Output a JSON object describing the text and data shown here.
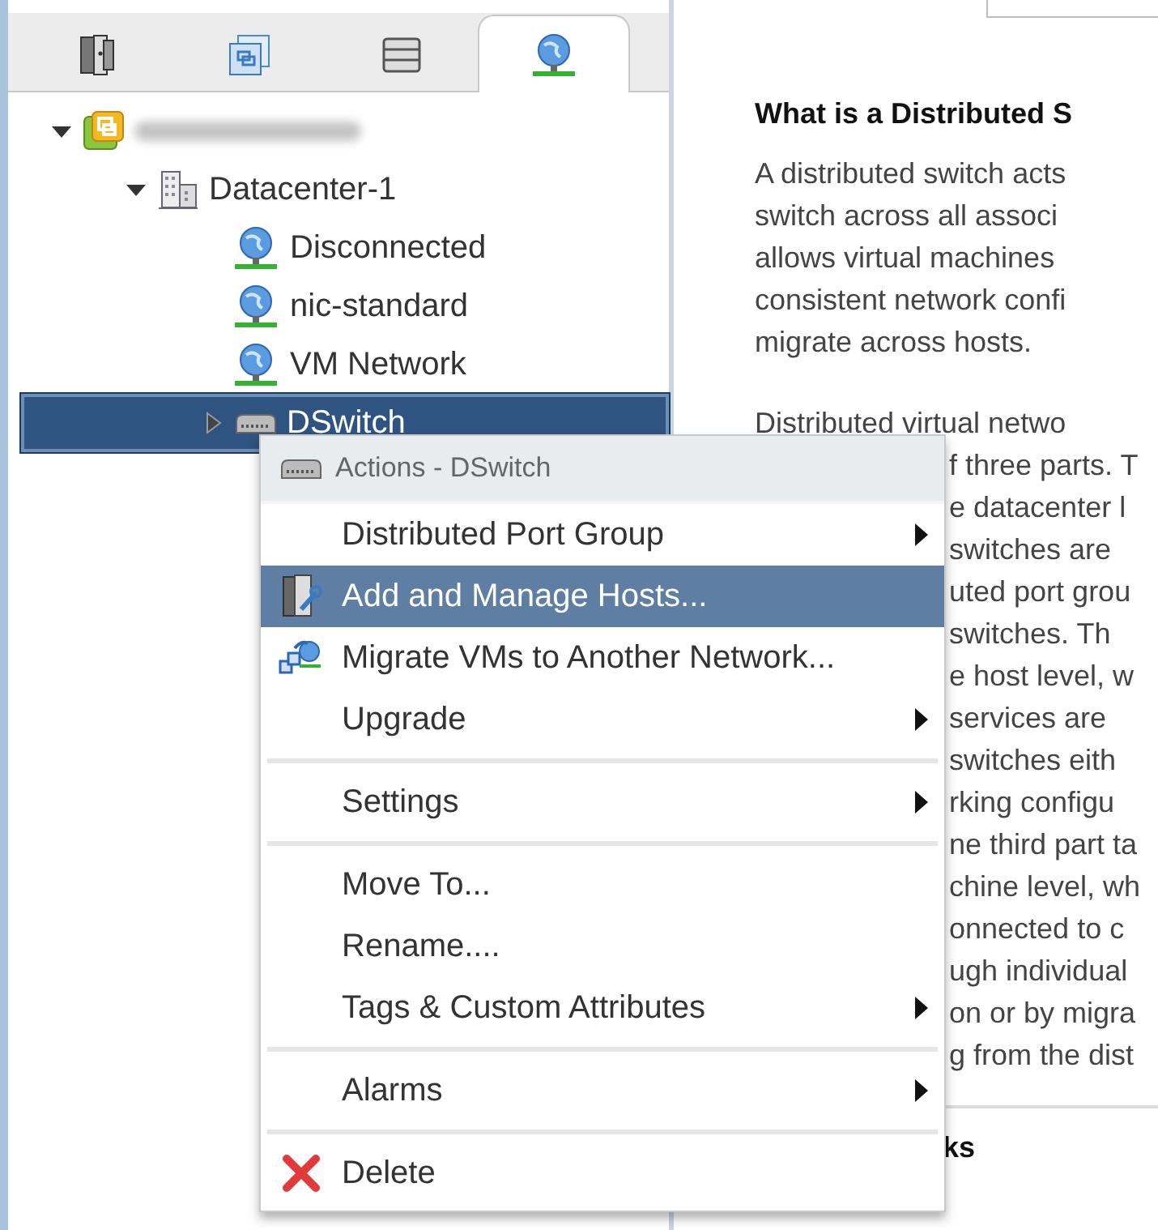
{
  "tabs": [
    {
      "kind": "hosts",
      "selected": false
    },
    {
      "kind": "vms",
      "selected": false
    },
    {
      "kind": "storage",
      "selected": false
    },
    {
      "kind": "network",
      "selected": true
    }
  ],
  "tree": [
    {
      "kind": "vcenter",
      "expanded": true,
      "selected": false,
      "children": [
        {
          "kind": "datacenter",
          "label": "Datacenter-1",
          "expanded": true,
          "selected": false,
          "children": [
            {
              "kind": "network",
              "label": "Disconnected",
              "selected": false
            },
            {
              "kind": "network",
              "label": "nic-standard",
              "selected": false
            },
            {
              "kind": "network",
              "label": "VM Network",
              "selected": false
            },
            {
              "kind": "dswitch",
              "label": "DSwitch",
              "expanded": false,
              "selected": true
            }
          ]
        }
      ]
    }
  ],
  "help": {
    "heading": "What is a Distributed S",
    "paragraph_1": [
      "A distributed switch acts",
      "switch across all associ",
      "allows virtual machines",
      "consistent network confi",
      "migrate across hosts."
    ],
    "paragraph_2_first": "Distributed virtual netwo",
    "paragraph_2_visible": [
      "f three parts. T",
      "e datacenter l",
      "switches are",
      "uted port grou",
      "switches. Th",
      "e host level, w",
      "services are",
      "switches eith",
      "rking configu",
      "ne third part ta",
      "chine level, wh",
      "onnected to c",
      "ugh individual",
      "on or by migra",
      "g from the dist"
    ],
    "section_heading": "ks"
  },
  "context_menu": {
    "title": "Actions - DSwitch",
    "groups": [
      [
        {
          "label": "Distributed Port Group",
          "submenu": true,
          "selected": false
        },
        {
          "label": "Add and Manage Hosts...",
          "kind": "hosts",
          "submenu": false,
          "selected": true
        },
        {
          "label": "Migrate VMs to Another Network...",
          "kind": "migrate",
          "submenu": false,
          "selected": false
        },
        {
          "label": "Upgrade",
          "submenu": true,
          "selected": false
        }
      ],
      [
        {
          "label": "Settings",
          "submenu": true,
          "selected": false
        }
      ],
      [
        {
          "label": "Move To...",
          "submenu": false,
          "selected": false
        },
        {
          "label": "Rename....",
          "submenu": false,
          "selected": false
        },
        {
          "label": "Tags & Custom Attributes",
          "submenu": true,
          "selected": false
        }
      ],
      [
        {
          "label": "Alarms",
          "submenu": true,
          "selected": false
        }
      ],
      [
        {
          "label": "Delete",
          "kind": "delete",
          "submenu": false,
          "selected": false
        }
      ]
    ]
  }
}
